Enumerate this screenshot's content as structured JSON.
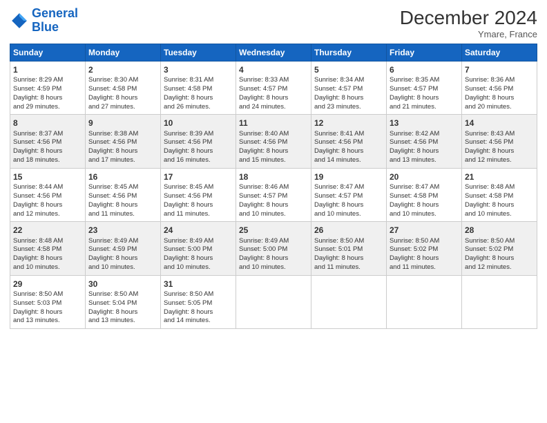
{
  "logo": {
    "line1": "General",
    "line2": "Blue"
  },
  "title": "December 2024",
  "subtitle": "Ymare, France",
  "days_header": [
    "Sunday",
    "Monday",
    "Tuesday",
    "Wednesday",
    "Thursday",
    "Friday",
    "Saturday"
  ],
  "weeks": [
    [
      {
        "day": "1",
        "lines": [
          "Sunrise: 8:29 AM",
          "Sunset: 4:59 PM",
          "Daylight: 8 hours",
          "and 29 minutes."
        ]
      },
      {
        "day": "2",
        "lines": [
          "Sunrise: 8:30 AM",
          "Sunset: 4:58 PM",
          "Daylight: 8 hours",
          "and 27 minutes."
        ]
      },
      {
        "day": "3",
        "lines": [
          "Sunrise: 8:31 AM",
          "Sunset: 4:58 PM",
          "Daylight: 8 hours",
          "and 26 minutes."
        ]
      },
      {
        "day": "4",
        "lines": [
          "Sunrise: 8:33 AM",
          "Sunset: 4:57 PM",
          "Daylight: 8 hours",
          "and 24 minutes."
        ]
      },
      {
        "day": "5",
        "lines": [
          "Sunrise: 8:34 AM",
          "Sunset: 4:57 PM",
          "Daylight: 8 hours",
          "and 23 minutes."
        ]
      },
      {
        "day": "6",
        "lines": [
          "Sunrise: 8:35 AM",
          "Sunset: 4:57 PM",
          "Daylight: 8 hours",
          "and 21 minutes."
        ]
      },
      {
        "day": "7",
        "lines": [
          "Sunrise: 8:36 AM",
          "Sunset: 4:56 PM",
          "Daylight: 8 hours",
          "and 20 minutes."
        ]
      }
    ],
    [
      {
        "day": "8",
        "lines": [
          "Sunrise: 8:37 AM",
          "Sunset: 4:56 PM",
          "Daylight: 8 hours",
          "and 18 minutes."
        ]
      },
      {
        "day": "9",
        "lines": [
          "Sunrise: 8:38 AM",
          "Sunset: 4:56 PM",
          "Daylight: 8 hours",
          "and 17 minutes."
        ]
      },
      {
        "day": "10",
        "lines": [
          "Sunrise: 8:39 AM",
          "Sunset: 4:56 PM",
          "Daylight: 8 hours",
          "and 16 minutes."
        ]
      },
      {
        "day": "11",
        "lines": [
          "Sunrise: 8:40 AM",
          "Sunset: 4:56 PM",
          "Daylight: 8 hours",
          "and 15 minutes."
        ]
      },
      {
        "day": "12",
        "lines": [
          "Sunrise: 8:41 AM",
          "Sunset: 4:56 PM",
          "Daylight: 8 hours",
          "and 14 minutes."
        ]
      },
      {
        "day": "13",
        "lines": [
          "Sunrise: 8:42 AM",
          "Sunset: 4:56 PM",
          "Daylight: 8 hours",
          "and 13 minutes."
        ]
      },
      {
        "day": "14",
        "lines": [
          "Sunrise: 8:43 AM",
          "Sunset: 4:56 PM",
          "Daylight: 8 hours",
          "and 12 minutes."
        ]
      }
    ],
    [
      {
        "day": "15",
        "lines": [
          "Sunrise: 8:44 AM",
          "Sunset: 4:56 PM",
          "Daylight: 8 hours",
          "and 12 minutes."
        ]
      },
      {
        "day": "16",
        "lines": [
          "Sunrise: 8:45 AM",
          "Sunset: 4:56 PM",
          "Daylight: 8 hours",
          "and 11 minutes."
        ]
      },
      {
        "day": "17",
        "lines": [
          "Sunrise: 8:45 AM",
          "Sunset: 4:56 PM",
          "Daylight: 8 hours",
          "and 11 minutes."
        ]
      },
      {
        "day": "18",
        "lines": [
          "Sunrise: 8:46 AM",
          "Sunset: 4:57 PM",
          "Daylight: 8 hours",
          "and 10 minutes."
        ]
      },
      {
        "day": "19",
        "lines": [
          "Sunrise: 8:47 AM",
          "Sunset: 4:57 PM",
          "Daylight: 8 hours",
          "and 10 minutes."
        ]
      },
      {
        "day": "20",
        "lines": [
          "Sunrise: 8:47 AM",
          "Sunset: 4:58 PM",
          "Daylight: 8 hours",
          "and 10 minutes."
        ]
      },
      {
        "day": "21",
        "lines": [
          "Sunrise: 8:48 AM",
          "Sunset: 4:58 PM",
          "Daylight: 8 hours",
          "and 10 minutes."
        ]
      }
    ],
    [
      {
        "day": "22",
        "lines": [
          "Sunrise: 8:48 AM",
          "Sunset: 4:58 PM",
          "Daylight: 8 hours",
          "and 10 minutes."
        ]
      },
      {
        "day": "23",
        "lines": [
          "Sunrise: 8:49 AM",
          "Sunset: 4:59 PM",
          "Daylight: 8 hours",
          "and 10 minutes."
        ]
      },
      {
        "day": "24",
        "lines": [
          "Sunrise: 8:49 AM",
          "Sunset: 5:00 PM",
          "Daylight: 8 hours",
          "and 10 minutes."
        ]
      },
      {
        "day": "25",
        "lines": [
          "Sunrise: 8:49 AM",
          "Sunset: 5:00 PM",
          "Daylight: 8 hours",
          "and 10 minutes."
        ]
      },
      {
        "day": "26",
        "lines": [
          "Sunrise: 8:50 AM",
          "Sunset: 5:01 PM",
          "Daylight: 8 hours",
          "and 11 minutes."
        ]
      },
      {
        "day": "27",
        "lines": [
          "Sunrise: 8:50 AM",
          "Sunset: 5:02 PM",
          "Daylight: 8 hours",
          "and 11 minutes."
        ]
      },
      {
        "day": "28",
        "lines": [
          "Sunrise: 8:50 AM",
          "Sunset: 5:02 PM",
          "Daylight: 8 hours",
          "and 12 minutes."
        ]
      }
    ],
    [
      {
        "day": "29",
        "lines": [
          "Sunrise: 8:50 AM",
          "Sunset: 5:03 PM",
          "Daylight: 8 hours",
          "and 13 minutes."
        ]
      },
      {
        "day": "30",
        "lines": [
          "Sunrise: 8:50 AM",
          "Sunset: 5:04 PM",
          "Daylight: 8 hours",
          "and 13 minutes."
        ]
      },
      {
        "day": "31",
        "lines": [
          "Sunrise: 8:50 AM",
          "Sunset: 5:05 PM",
          "Daylight: 8 hours",
          "and 14 minutes."
        ]
      },
      {
        "day": "",
        "lines": []
      },
      {
        "day": "",
        "lines": []
      },
      {
        "day": "",
        "lines": []
      },
      {
        "day": "",
        "lines": []
      }
    ]
  ]
}
